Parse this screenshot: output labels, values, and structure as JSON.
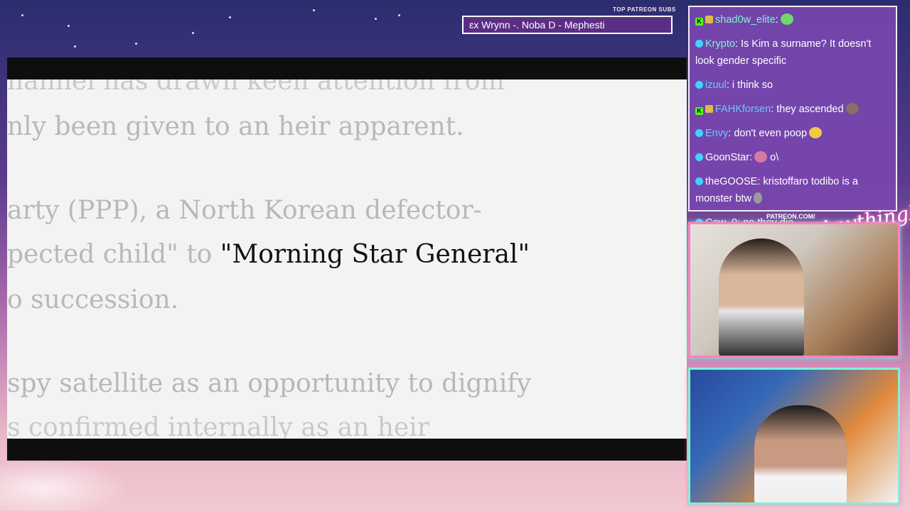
{
  "patreon_ticker": {
    "label": "TOP PATREON SUBS",
    "text": "ɛx Wrynn -. Noba D - Mephesti"
  },
  "article": {
    "lines": [
      "hannel has drawn keen attention from",
      "nly been given to an heir apparent.",
      "arty (PPP), a North Korean defector-",
      "pected child\" to ",
      "o succession.",
      " spy satellite as an opportunity to dignify",
      "s confirmed internally as an heir"
    ],
    "highlight": "\"Morning Star General\""
  },
  "chat": {
    "messages": [
      {
        "badges": [
          "kick",
          "sub"
        ],
        "user": "shad0w_elite",
        "text": "",
        "emote": "green-emote"
      },
      {
        "badges": [
          "bot"
        ],
        "user": "Krypto",
        "text": "Is Kim a surname? It doesn't look gender specific"
      },
      {
        "badges": [
          "bot"
        ],
        "user": "izuul",
        "text": "i think so"
      },
      {
        "badges": [
          "kick",
          "sub"
        ],
        "user": "FAHKforsen",
        "text": "they ascended",
        "emote": "face-emote"
      },
      {
        "badges": [
          "bot"
        ],
        "user": "Envy",
        "text": "don't even poop",
        "emote": "sunglasses-emote"
      },
      {
        "badges": [
          "bot"
        ],
        "user": "GoonStar",
        "text": " o\\",
        "emote": "pink-emote"
      },
      {
        "badges": [
          "bot"
        ],
        "user": "theGOOSE",
        "text": "kristoffaro todibo is a monster btw",
        "emote": "moai-emote"
      },
      {
        "badges": [
          "bot"
        ],
        "user": "Cow_9",
        "text": "no they die"
      }
    ]
  },
  "overlay": {
    "patreon_url": "PATREON.COM/",
    "brand": "AnythingElse"
  }
}
